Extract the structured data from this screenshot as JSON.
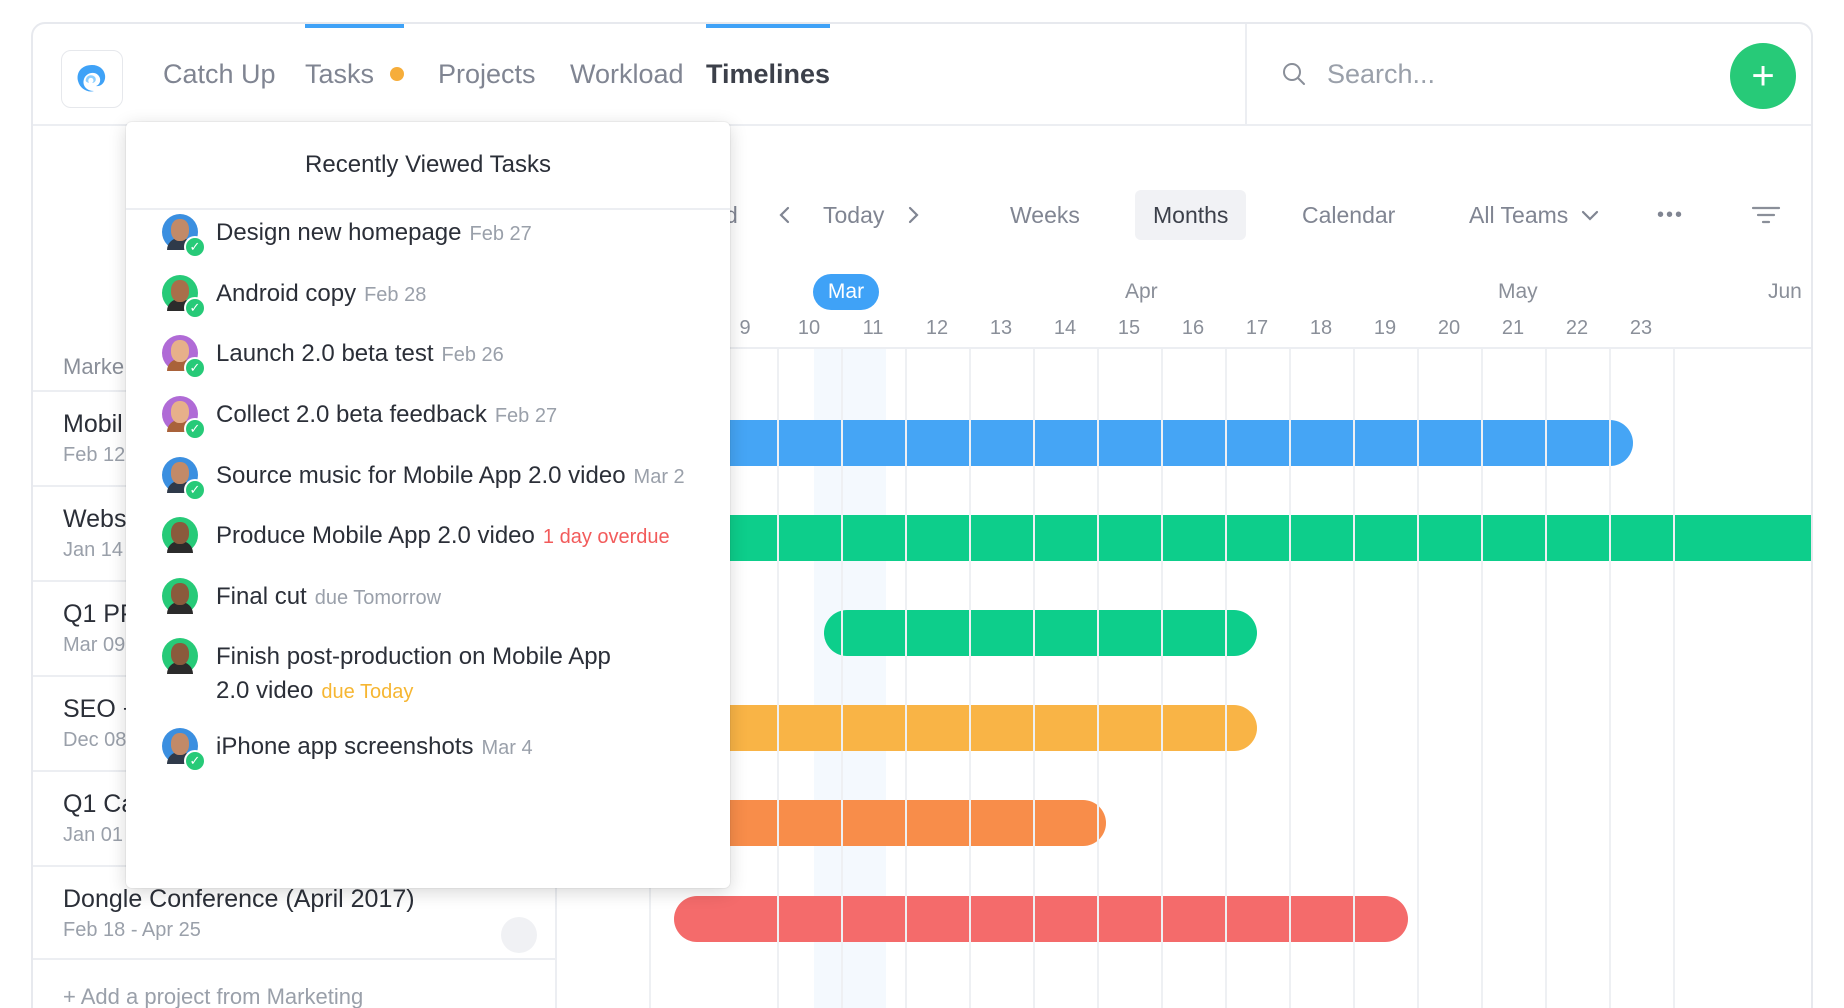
{
  "app": {
    "nav_tabs": [
      {
        "label": "Catch Up"
      },
      {
        "label": "Tasks"
      },
      {
        "label": "Projects"
      },
      {
        "label": "Workload"
      },
      {
        "label": "Timelines"
      }
    ],
    "active_tab": "Timelines",
    "search_placeholder": "Search...",
    "add_button": "+",
    "colors": {
      "accent": "#3fa2f7",
      "add": "#27ca78",
      "notification_dot": "#f6ad3a"
    }
  },
  "sidebar": {
    "section_label": "Marke",
    "projects": [
      {
        "name": "Mobil",
        "dates": "Feb 12 -"
      },
      {
        "name": "Webs",
        "dates": "Jan 14 -"
      },
      {
        "name": "Q1 PP",
        "dates": "Mar 09"
      },
      {
        "name": "SEO +",
        "dates": "Dec 08"
      },
      {
        "name": "Q1 Ca",
        "dates": "Jan 01 -"
      },
      {
        "name": "Dongle Conference (April 2017)",
        "dates": "Feb 18 - Apr 25"
      }
    ],
    "add_project": "+ Add a project from Marketing"
  },
  "toolbar": {
    "partial_label": "d",
    "prev_icon": "chevron-left-icon",
    "today": "Today",
    "next_icon": "chevron-right-icon",
    "weeks": "Weeks",
    "months": "Months",
    "calendar": "Calendar",
    "teams": "All Teams",
    "more": "•••",
    "selected_view": "Months"
  },
  "timeline": {
    "months": [
      "Mar",
      "Apr",
      "May",
      "Jun"
    ],
    "weeks": [
      "9",
      "10",
      "11",
      "12",
      "13",
      "14",
      "15",
      "16",
      "17",
      "18",
      "19",
      "20",
      "21",
      "22",
      "23"
    ],
    "current_week": "10",
    "bars": [
      {
        "project": "Mobil",
        "color": "#45a5f5"
      },
      {
        "project": "Webs",
        "color": "#0dce8b"
      },
      {
        "project": "Q1 PP",
        "color": "#0dce8b"
      },
      {
        "project": "SEO +",
        "color": "#f9b446"
      },
      {
        "project": "Q1 Ca",
        "color": "#f88d4a"
      },
      {
        "project": "Dongle Conference (April 2017)",
        "color": "#f46b6b"
      }
    ]
  },
  "popover": {
    "title": "Recently Viewed Tasks",
    "tasks": [
      {
        "title": "Design new homepage",
        "meta": "Feb 27",
        "completed": true
      },
      {
        "title": "Android copy",
        "meta": "Feb 28",
        "completed": true
      },
      {
        "title": "Launch 2.0 beta test",
        "meta": "Feb 26",
        "completed": true
      },
      {
        "title": "Collect 2.0 beta feedback",
        "meta": "Feb 27",
        "completed": true
      },
      {
        "title": "Source music for Mobile App 2.0 video",
        "meta": "Mar 2",
        "completed": true
      },
      {
        "title": "Produce Mobile App 2.0 video",
        "meta": "1 day overdue",
        "completed": false,
        "status": "overdue"
      },
      {
        "title": "Final cut",
        "meta": "due Tomorrow",
        "completed": false
      },
      {
        "title": "Finish post-production on Mobile App 2.0 video",
        "meta": "due Today",
        "completed": false,
        "status": "due-today"
      },
      {
        "title": "iPhone app screenshots",
        "meta": "Mar 4",
        "completed": true
      }
    ]
  }
}
